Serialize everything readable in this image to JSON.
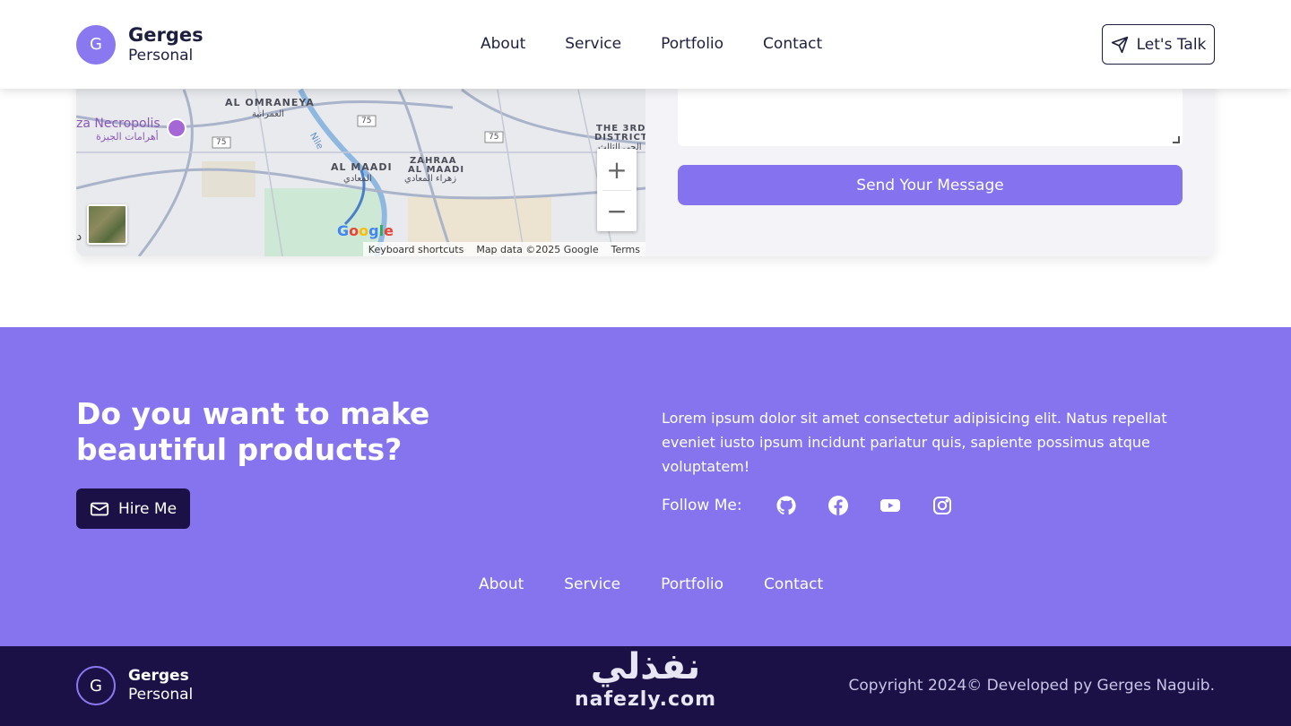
{
  "header": {
    "logo_letter": "G",
    "brand_name": "Gerges",
    "brand_sub": "Personal",
    "nav": [
      "About",
      "Service",
      "Portfolio",
      "Contact"
    ],
    "cta_label": "Let's Talk",
    "cta_icon": "send-icon"
  },
  "map": {
    "labels": {
      "omraneya": "AL OMRANEYA",
      "omraneya_ar": "العمرانية",
      "maadi": "AL MAADI",
      "maadi_ar": "المعادي",
      "zahraa_1": "ZAHRAA",
      "zahraa_2": "AL MAADI",
      "zahraa_ar": "زهراء المعادي",
      "district_1": "THE 3RD",
      "district_2": "DISTRICT",
      "district_ar": "الحي الثالث",
      "nile": "Nile",
      "road_1": "75",
      "road_2": "75",
      "road_3": "75"
    },
    "poi": "za Necropolis",
    "poi_ar": "أهرامات الجيزة",
    "zoom_in": "+",
    "zoom_out": "−",
    "google": [
      "G",
      "o",
      "o",
      "g",
      "l",
      "e"
    ],
    "attribution": [
      "Keyboard shortcuts",
      "Map data ©2025 Google",
      "Terms"
    ],
    "edge_glyph": "د"
  },
  "form": {
    "send_label": "Send Your Message"
  },
  "cta": {
    "heading": "Do you want to make beautiful products?",
    "hire_label": "Hire Me",
    "hire_icon": "mail-icon",
    "text": "Lorem ipsum dolor sit amet consectetur adipisicing elit. Natus repellat eveniet iusto ipsum incidunt pariatur quis, sapiente possimus atque voluptatem!",
    "follow_label": "Follow Me:",
    "socials": [
      "github-icon",
      "facebook-icon",
      "youtube-icon",
      "instagram-icon"
    ],
    "footer_nav": [
      "About",
      "Service",
      "Portfolio",
      "Contact"
    ]
  },
  "footer": {
    "logo_letter": "G",
    "brand_name": "Gerges",
    "brand_sub": "Personal",
    "watermark_ar": "نفذلي",
    "watermark_en": "nafezly.com",
    "copyright": "Copyright 2024© Developed py Gerges Naguib."
  },
  "colors": {
    "accent": "#8574ee",
    "dark": "#1b1147",
    "text": "#1d1f3e"
  }
}
